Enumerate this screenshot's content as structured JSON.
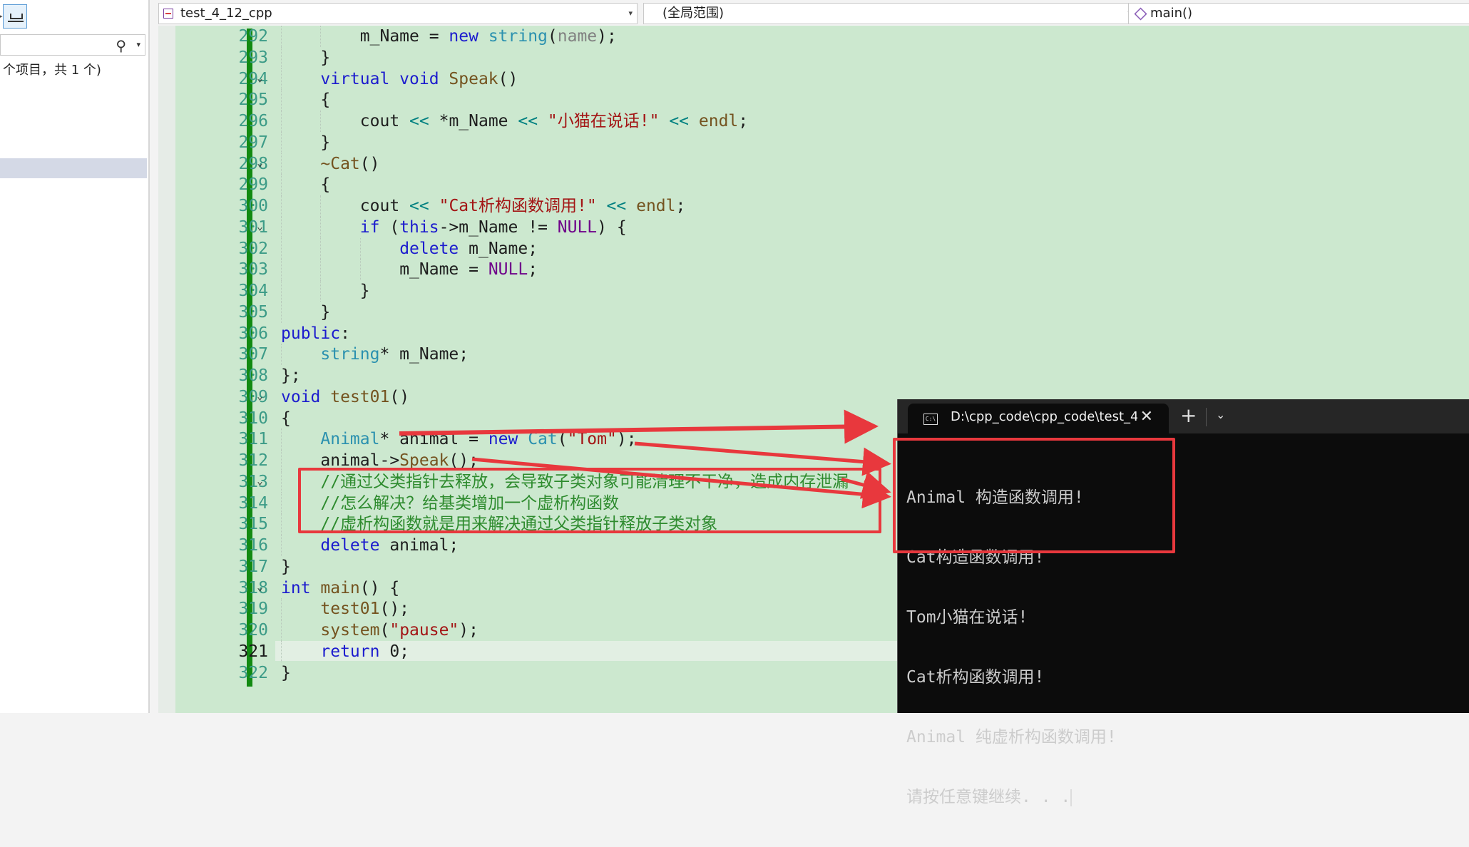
{
  "left_panel": {
    "count_text": "个项目，共 1 个)"
  },
  "nav": {
    "file": "test_4_12_cpp",
    "scope": "(全局范围)",
    "member": "main()"
  },
  "editor": {
    "lines": [
      {
        "n": "292",
        "fold": "",
        "indent": 2,
        "tokens": [
          [
            "n",
            "m_Name = "
          ],
          [
            "k",
            "new "
          ],
          [
            "t",
            "string"
          ],
          [
            "n",
            "("
          ],
          [
            "g",
            "name"
          ],
          [
            "n",
            ");"
          ]
        ]
      },
      {
        "n": "293",
        "fold": "",
        "indent": 1,
        "tokens": [
          [
            "n",
            "}"
          ]
        ]
      },
      {
        "n": "294",
        "fold": "v",
        "indent": 1,
        "tokens": [
          [
            "k",
            "virtual void "
          ],
          [
            "f",
            "Speak"
          ],
          [
            "n",
            "()"
          ]
        ]
      },
      {
        "n": "295",
        "fold": "",
        "indent": 1,
        "tokens": [
          [
            "n",
            "{"
          ]
        ]
      },
      {
        "n": "296",
        "fold": "",
        "indent": 2,
        "tokens": [
          [
            "n",
            "cout "
          ],
          [
            "o",
            "<< "
          ],
          [
            "n",
            "*m_Name "
          ],
          [
            "o",
            "<< "
          ],
          [
            "s",
            "\"小猫在说话!\""
          ],
          [
            "n",
            " "
          ],
          [
            "o",
            "<< "
          ],
          [
            "f",
            "endl"
          ],
          [
            "n",
            ";"
          ]
        ]
      },
      {
        "n": "297",
        "fold": "",
        "indent": 1,
        "tokens": [
          [
            "n",
            "}"
          ]
        ]
      },
      {
        "n": "298",
        "fold": "v",
        "indent": 1,
        "tokens": [
          [
            "f",
            "~Cat"
          ],
          [
            "n",
            "()"
          ]
        ]
      },
      {
        "n": "299",
        "fold": "",
        "indent": 1,
        "tokens": [
          [
            "n",
            "{"
          ]
        ]
      },
      {
        "n": "300",
        "fold": "",
        "indent": 2,
        "tokens": [
          [
            "n",
            "cout "
          ],
          [
            "o",
            "<< "
          ],
          [
            "s",
            "\"Cat析构函数调用!\""
          ],
          [
            "n",
            " "
          ],
          [
            "o",
            "<< "
          ],
          [
            "f",
            "endl"
          ],
          [
            "n",
            ";"
          ]
        ]
      },
      {
        "n": "301",
        "fold": "v",
        "indent": 2,
        "tokens": [
          [
            "k",
            "if "
          ],
          [
            "n",
            "("
          ],
          [
            "k",
            "this"
          ],
          [
            "n",
            "->m_Name != "
          ],
          [
            "p",
            "NULL"
          ],
          [
            "n",
            ") {"
          ]
        ]
      },
      {
        "n": "302",
        "fold": "",
        "indent": 3,
        "tokens": [
          [
            "k",
            "delete "
          ],
          [
            "n",
            "m_Name;"
          ]
        ]
      },
      {
        "n": "303",
        "fold": "",
        "indent": 3,
        "tokens": [
          [
            "n",
            "m_Name = "
          ],
          [
            "p",
            "NULL"
          ],
          [
            "n",
            ";"
          ]
        ]
      },
      {
        "n": "304",
        "fold": "",
        "indent": 2,
        "tokens": [
          [
            "n",
            "}"
          ]
        ]
      },
      {
        "n": "305",
        "fold": "",
        "indent": 1,
        "tokens": [
          [
            "n",
            "}"
          ]
        ]
      },
      {
        "n": "306",
        "fold": "",
        "indent": 0,
        "tokens": [
          [
            "k",
            "public"
          ],
          [
            "n",
            ":"
          ]
        ]
      },
      {
        "n": "307",
        "fold": "",
        "indent": 1,
        "tokens": [
          [
            "t",
            "string"
          ],
          [
            "n",
            "* m_Name;"
          ]
        ]
      },
      {
        "n": "308",
        "fold": "",
        "indent": 0,
        "tokens": [
          [
            "n",
            "};"
          ]
        ]
      },
      {
        "n": "309",
        "fold": "v",
        "indent": 0,
        "tokens": [
          [
            "k",
            "void "
          ],
          [
            "f",
            "test01"
          ],
          [
            "n",
            "()"
          ]
        ]
      },
      {
        "n": "310",
        "fold": "",
        "indent": 0,
        "tokens": [
          [
            "n",
            "{"
          ]
        ]
      },
      {
        "n": "311",
        "fold": "",
        "indent": 1,
        "tokens": [
          [
            "t",
            "Animal"
          ],
          [
            "n",
            "* animal = "
          ],
          [
            "k",
            "new "
          ],
          [
            "t",
            "Cat"
          ],
          [
            "n",
            "("
          ],
          [
            "s",
            "\"Tom\""
          ],
          [
            "n",
            ");"
          ]
        ]
      },
      {
        "n": "312",
        "fold": "",
        "indent": 1,
        "tokens": [
          [
            "n",
            "animal->"
          ],
          [
            "f",
            "Speak"
          ],
          [
            "n",
            "();"
          ]
        ]
      },
      {
        "n": "313",
        "fold": "v",
        "indent": 1,
        "tokens": [
          [
            "c",
            "//通过父类指针去释放，会导致子类对象可能清理不干净，造成内存泄漏"
          ]
        ]
      },
      {
        "n": "314",
        "fold": "",
        "indent": 1,
        "tokens": [
          [
            "c",
            "//怎么解决？给基类增加一个虚析构函数"
          ]
        ]
      },
      {
        "n": "315",
        "fold": "",
        "indent": 1,
        "tokens": [
          [
            "c",
            "//虚析构函数就是用来解决通过父类指针释放子类对象"
          ]
        ]
      },
      {
        "n": "316",
        "fold": "",
        "indent": 1,
        "tokens": [
          [
            "k",
            "delete "
          ],
          [
            "n",
            "animal;"
          ]
        ]
      },
      {
        "n": "317",
        "fold": "",
        "indent": 0,
        "tokens": [
          [
            "n",
            "}"
          ]
        ]
      },
      {
        "n": "318",
        "fold": "v",
        "indent": 0,
        "tokens": [
          [
            "k",
            "int "
          ],
          [
            "f",
            "main"
          ],
          [
            "n",
            "() {"
          ]
        ]
      },
      {
        "n": "319",
        "fold": "",
        "indent": 1,
        "tokens": [
          [
            "f",
            "test01"
          ],
          [
            "n",
            "();"
          ]
        ]
      },
      {
        "n": "320",
        "fold": "",
        "indent": 1,
        "tokens": [
          [
            "f",
            "system"
          ],
          [
            "n",
            "("
          ],
          [
            "s",
            "\"pause\""
          ],
          [
            "n",
            ");"
          ]
        ]
      },
      {
        "n": "321",
        "fold": "",
        "indent": 1,
        "current": true,
        "tokens": [
          [
            "k",
            "return "
          ],
          [
            "n",
            "0;"
          ]
        ]
      },
      {
        "n": "322",
        "fold": "",
        "indent": 0,
        "tokens": [
          [
            "n",
            "}"
          ]
        ]
      }
    ]
  },
  "terminal": {
    "tab_title": "D:\\cpp_code\\cpp_code\\test_4_",
    "tab_icon_label": "C:\\",
    "new_tab": "+",
    "output": [
      "Animal 构造函数调用!",
      "Cat构造函数调用!",
      "Tom小猫在说话!",
      "Cat析构函数调用!",
      "Animal 纯虚析构函数调用!",
      "请按任意键继续. . ."
    ]
  },
  "colors": {
    "editor_bg": "#cce8cf",
    "keyword": "#1c1cce",
    "type": "#2b91af",
    "string": "#a31515",
    "comment": "#2e8b2e",
    "annotation_red": "#e8383d",
    "terminal_bg": "#0c0c0c"
  },
  "icons": [
    "solution-explorer-tool-icon",
    "search-icon",
    "file-code-icon",
    "member-cube-icon",
    "terminal-icon",
    "close-icon",
    "plus-icon",
    "chevron-down-icon"
  ]
}
